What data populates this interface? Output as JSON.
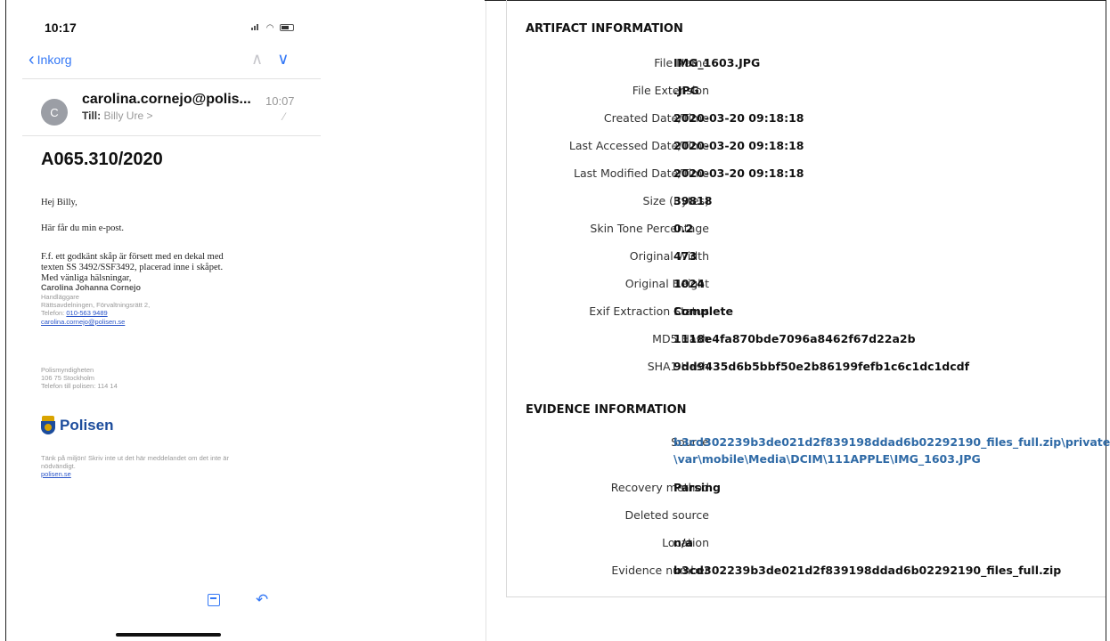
{
  "phone": {
    "status_time": "10:17",
    "back_label": "Inkorg",
    "sender": "carolina.cornejo@polis...",
    "time": "10:07",
    "to_label": "Till:",
    "to_value": "Billy Ure >",
    "subject": "A065.310/2020",
    "greeting": "Hej Billy,",
    "line1": "Här får du min e-post.",
    "para1": "F.f. ett godkänt skåp är försett med en dekal med",
    "para2": "texten SS 3492/SSF3492, placerad inne i skåpet.",
    "para3": "Med vänliga hälsningar,",
    "sig_name": "Carolina Johanna Cornejo",
    "sig_role": "Handläggare",
    "sig_dept": "Rättsavdelningen, Förvaltningsrätt 2,",
    "sig_phone_label": "Telefon:",
    "sig_phone": "010-563 9489",
    "sig_email": "carolina.cornejo@polisen.se",
    "org": "Polismyndigheten",
    "address": "106 75 Stockholm",
    "org_phone": "Telefon till polisen: 114 14",
    "logo_text": "Polisen",
    "footer1": "Tänk på miljön! Skriv inte ut det här meddelandet om det inte är",
    "footer2": "nödvändigt.",
    "footer_link": "polisen.se"
  },
  "artifact": {
    "title": "ARTIFACT INFORMATION",
    "rows": [
      {
        "label": "File Name",
        "value": "IMG_1603.JPG"
      },
      {
        "label": "File Extension",
        "value": ".JPG"
      },
      {
        "label": "Created Date/Time",
        "value": "2020-03-20 09:18:18"
      },
      {
        "label": "Last Accessed Date/Time",
        "value": "2020-03-20 09:18:18"
      },
      {
        "label": "Last Modified Date/Time",
        "value": "2020-03-20 09:18:18"
      },
      {
        "label": "Size (Bytes)",
        "value": "39818"
      },
      {
        "label": "Skin Tone Percentage",
        "value": "0.2"
      },
      {
        "label": "Original Width",
        "value": "473"
      },
      {
        "label": "Original Height",
        "value": "1024"
      },
      {
        "label": "Exif Extraction Status",
        "value": "Complete"
      },
      {
        "label": "MD5 Hash",
        "value": "1118e4fa870bde7096a8462f67d22a2b"
      },
      {
        "label": "SHA1 Hash",
        "value": "9dd9435d6b5bbf50e2b86199fefb1c6c1dc1dcdf"
      }
    ]
  },
  "evidence": {
    "title": "EVIDENCE INFORMATION",
    "source_label": "Source",
    "source_line1": "b3cd302239b3de021d2f839198ddad6b02292190_files_full.zip\\private",
    "source_line2": "\\var\\mobile\\Media\\DCIM\\111APPLE\\IMG_1603.JPG",
    "recovery_label": "Recovery method",
    "recovery_value": "Parsing",
    "deleted_label": "Deleted source",
    "deleted_value": "",
    "location_label": "Location",
    "location_value": "n/a",
    "evidence_number_label": "Evidence number",
    "evidence_number_value": "b3cd302239b3de021d2f839198ddad6b02292190_files_full.zip"
  },
  "colors": {
    "ios_blue": "#3478f6",
    "link_blue": "#2f6aa6",
    "polisen_blue": "#1c4c9c"
  }
}
